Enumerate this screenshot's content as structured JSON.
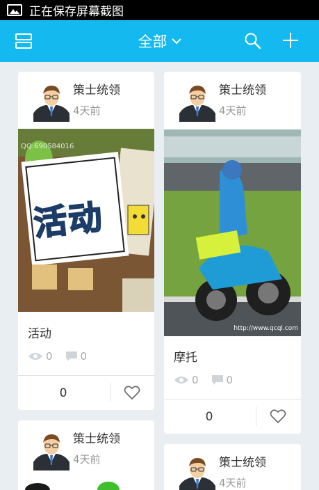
{
  "status_bar": {
    "text": "正在保存屏幕截图",
    "icon": "image-icon"
  },
  "header": {
    "title": "全部",
    "menu_icon": "layout-icon",
    "search_icon": "search-icon",
    "add_icon": "plus-icon",
    "color": "#13b9ef"
  },
  "cards": [
    {
      "author": "策士统领",
      "time": "4天前",
      "caption": "活动",
      "photo_text": "活动",
      "watermark": "QQ:690584016",
      "views": "0",
      "comments": "0",
      "likes": "0"
    },
    {
      "author": "策士统领",
      "time": "4天前",
      "caption": "摩托",
      "photo_watermark": "http://www.qcql.com",
      "views": "0",
      "comments": "0",
      "likes": "0"
    },
    {
      "author": "策士统领",
      "time": "4天前"
    },
    {
      "author": "策士统领",
      "time": "4天前"
    }
  ]
}
